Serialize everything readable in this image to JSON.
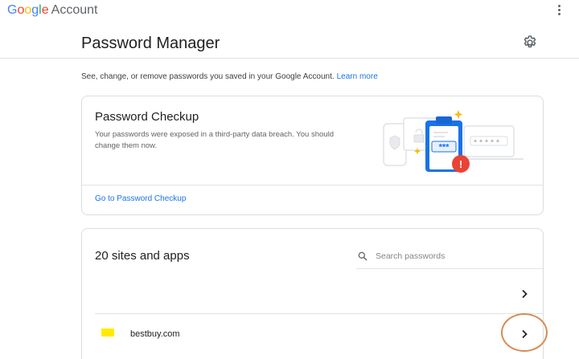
{
  "header": {
    "logo_google": [
      "G",
      "o",
      "o",
      "g",
      "l",
      "e"
    ],
    "logo_account": "Account"
  },
  "page": {
    "title": "Password Manager",
    "intro_text": "See, change, or remove passwords you saved in your Google Account.",
    "intro_link": "Learn more"
  },
  "checkup": {
    "title": "Password Checkup",
    "description": "Your passwords were exposed in a third-party data breach. You should change them now.",
    "link": "Go to Password Checkup",
    "illustration_mask": "***",
    "alert_glyph": "!"
  },
  "sites": {
    "title": "20 sites and apps",
    "search_placeholder": "Search passwords",
    "search_value": "",
    "rows": [
      {
        "name": "",
        "favicon": ""
      },
      {
        "name": "bestbuy.com",
        "favicon": "yellow-favicon"
      }
    ]
  },
  "colors": {
    "accent": "#1a73e8",
    "alert": "#ea4335",
    "clipboard": "#1a73e8",
    "sparkle": "#fbbc05",
    "annotation": "#d98b55"
  }
}
